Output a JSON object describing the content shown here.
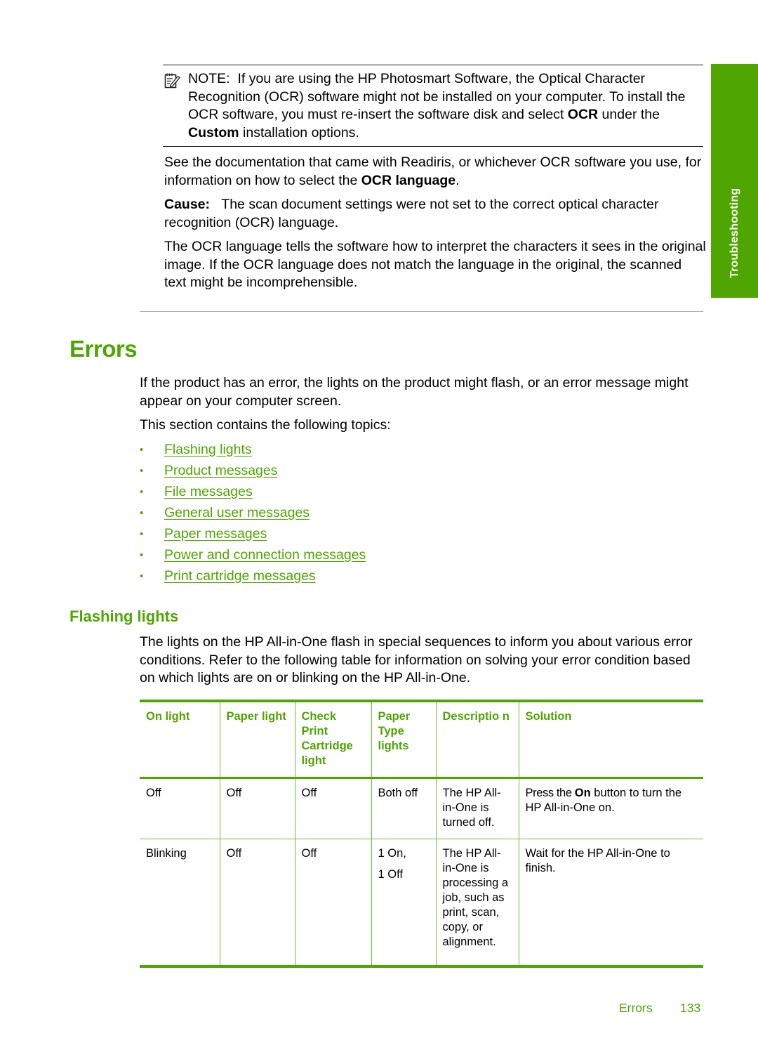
{
  "side_tab": {
    "label": "Troubleshooting",
    "color": "#4fa600"
  },
  "note": {
    "icon": "note-pencil-icon",
    "label": "NOTE:",
    "text_1": "If you are using the HP Photosmart Software, the Optical Character Recognition (OCR) software might not be installed on your computer. To install the OCR software, you must re-insert the software disk and select ",
    "bold_1": "OCR",
    "text_2": " under the ",
    "bold_2": "Custom",
    "text_3": " installation options."
  },
  "ocr_paragraph": {
    "text_1": "See the documentation that came with Readiris, or whichever OCR software you use, for information on how to select the ",
    "bold_1": "OCR language",
    "text_2": "."
  },
  "cause": {
    "label": "Cause:",
    "text": "The scan document settings were not set to the correct optical character recognition (OCR) language."
  },
  "ocr_explanation": "The OCR language tells the software how to interpret the characters it sees in the original image. If the OCR language does not match the language in the original, the scanned text might be incomprehensible.",
  "errors_section": {
    "heading": "Errors",
    "intro": "If the product has an error, the lights on the product might flash, or an error message might appear on your computer screen.",
    "topics_intro": "This section contains the following topics:",
    "topics": [
      "Flashing lights",
      "Product messages",
      "File messages",
      "General user messages",
      "Paper messages",
      "Power and connection messages",
      "Print cartridge messages"
    ]
  },
  "flashing_lights": {
    "heading": "Flashing lights",
    "intro": "The lights on the HP All-in-One flash in special sequences to inform you about various error conditions. Refer to the following table for information on solving your error condition based on which lights are on or blinking on the HP All-in-One.",
    "table": {
      "headers": [
        "On light",
        "Paper light",
        "Check Print Cartridge light",
        "Paper Type lights",
        "Descriptio n",
        "Solution"
      ],
      "rows": [
        {
          "on_light": "Off",
          "paper_light": "Off",
          "check_print_cartridge_light": "Off",
          "paper_type_lights": [
            "Both off"
          ],
          "description": "The HP All-in-One is turned off.",
          "solution_pre": "Press the ",
          "solution_bold": "On",
          "solution_post": " button to turn the HP All-in-One on."
        },
        {
          "on_light": "Blinking",
          "paper_light": "Off",
          "check_print_cartridge_light": "Off",
          "paper_type_lights": [
            "1 On,",
            "1 Off"
          ],
          "description": "The HP All-in-One is processing a job, such as print, scan, copy, or alignment.",
          "solution_pre": "Wait for the HP All-in-One to finish.",
          "solution_bold": "",
          "solution_post": ""
        }
      ]
    }
  },
  "footer": {
    "section": "Errors",
    "page_number": "133"
  },
  "colors": {
    "accent_green": "#4ea600",
    "rule_green": "#6cc02c",
    "text": "#000000"
  }
}
